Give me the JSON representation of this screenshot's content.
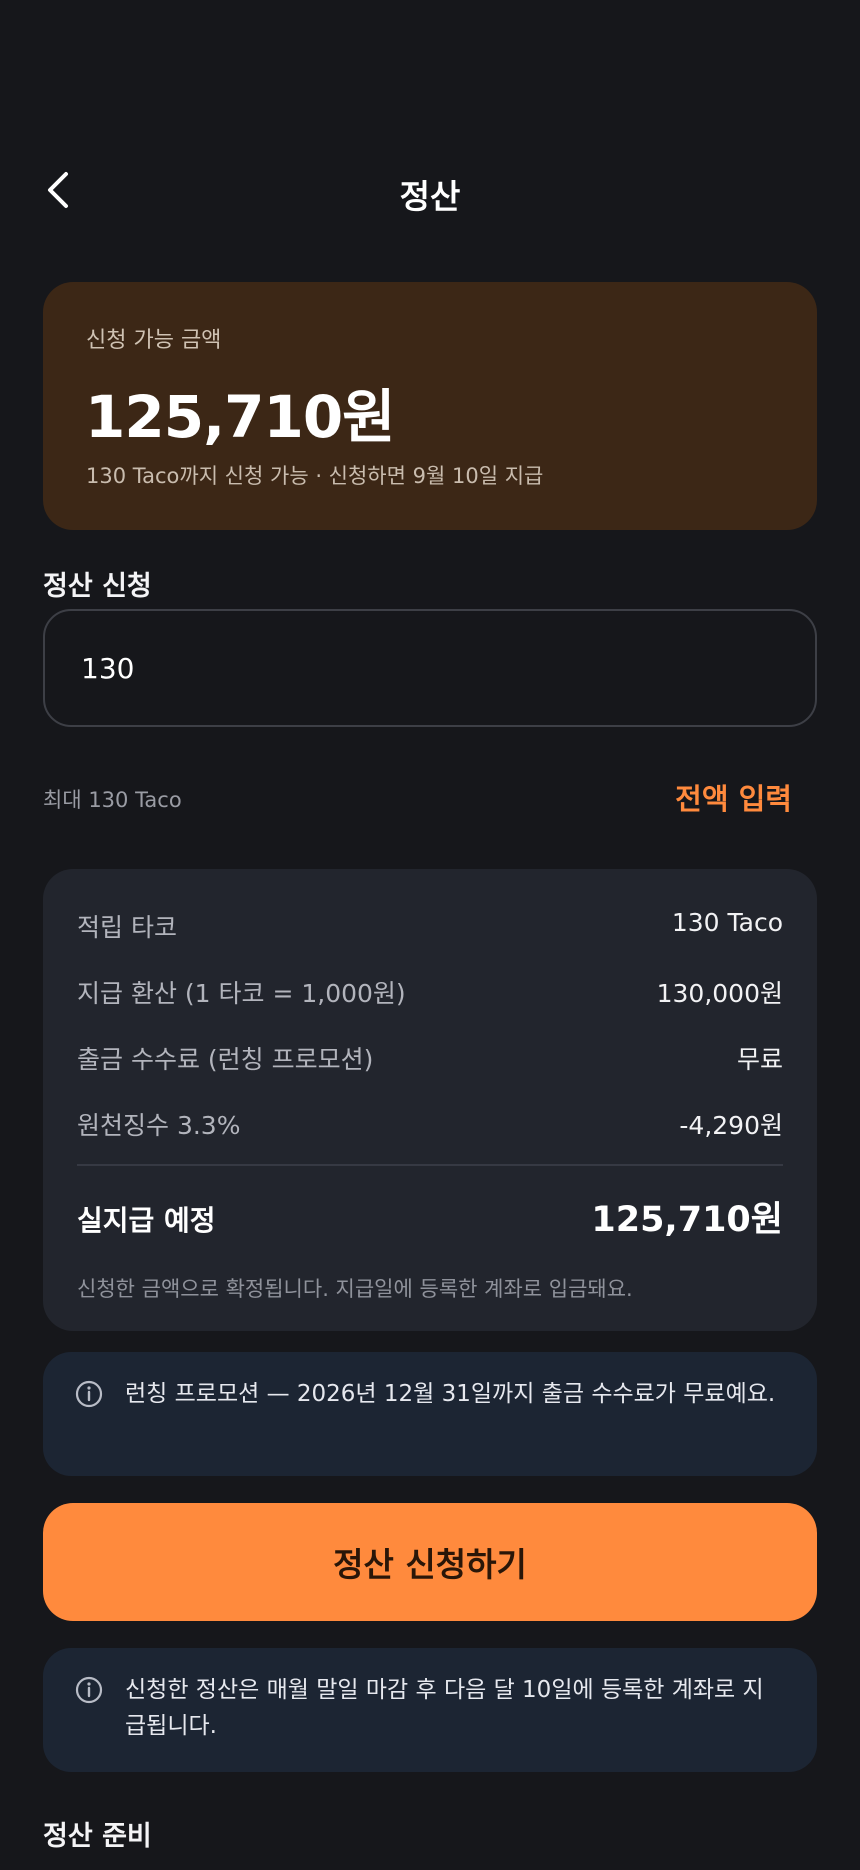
{
  "header": {
    "title": "정산",
    "back_icon": "chevron-left-icon"
  },
  "available": {
    "label": "신청 가능 금액",
    "amount": "125,710원",
    "note": "130 Taco까지 신청 가능 · 신청하면 9월 10일 지급"
  },
  "request": {
    "label": "정산 신청",
    "input_value": "130",
    "max_hint": "최대 130 Taco",
    "fill_all_label": "전액 입력"
  },
  "summary": {
    "rows": [
      {
        "label": "적립 타코",
        "value": "130 Taco"
      },
      {
        "label": "지급 환산 (1 타코 = 1,000원)",
        "value": "130,000원"
      },
      {
        "label": "출금 수수료 (런칭 프로모션)",
        "value": "무료"
      },
      {
        "label": "원천징수 3.3%",
        "value": "-4,290원"
      }
    ],
    "total_label": "실지급 예정",
    "total_value": "125,710원",
    "footnote": "신청한 금액으로 확정됩니다. 지급일에 등록한 계좌로 입금돼요."
  },
  "promo_notice": {
    "icon": "info-icon",
    "text": "런칭 프로모션 — 2026년 12월 31일까지 출금 수수료가 무료예요."
  },
  "cta": {
    "label": "정산 신청하기"
  },
  "schedule_notice": {
    "icon": "info-icon",
    "text": "신청한 정산은 매월 말일 마감 후 다음 달 10일에 등록한 계좌로 지급됩니다."
  },
  "prep_section": {
    "label": "정산 준비"
  },
  "colors": {
    "accent": "#ff8a3d",
    "background": "#16171b",
    "card": "#22252d",
    "available_card": "#3c2716",
    "notice": "#1c2533"
  }
}
